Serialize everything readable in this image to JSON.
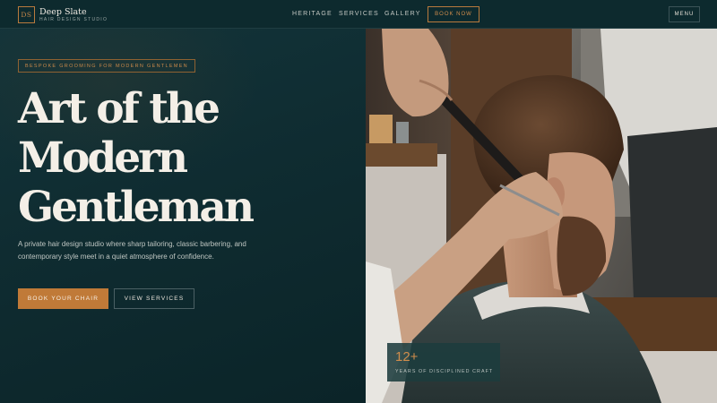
{
  "brand": {
    "monogram": "DS",
    "name": "Deep Slate",
    "tagline": "HAIR DESIGN STUDIO"
  },
  "nav": {
    "links": [
      "HERITAGE",
      "SERVICES",
      "GALLERY"
    ],
    "book_label": "BOOK NOW",
    "menu_label": "MENU"
  },
  "hero": {
    "eyebrow": "BESPOKE GROOMING FOR MODERN GENTLEMEN",
    "headline": [
      "Art of the",
      "Modern",
      "Gentleman"
    ],
    "description": "A private hair design studio where sharp tailoring, classic barbering, and contemporary style meet in a quiet atmosphere of confidence.",
    "primary_cta": "BOOK YOUR CHAIR",
    "secondary_cta": "VIEW SERVICES"
  },
  "stat": {
    "value": "12+",
    "label": "YEARS OF DISCIPLINED CRAFT"
  },
  "colors": {
    "accent": "#c07a38",
    "background": "#0c2327",
    "nav": "#0d2a2e"
  }
}
